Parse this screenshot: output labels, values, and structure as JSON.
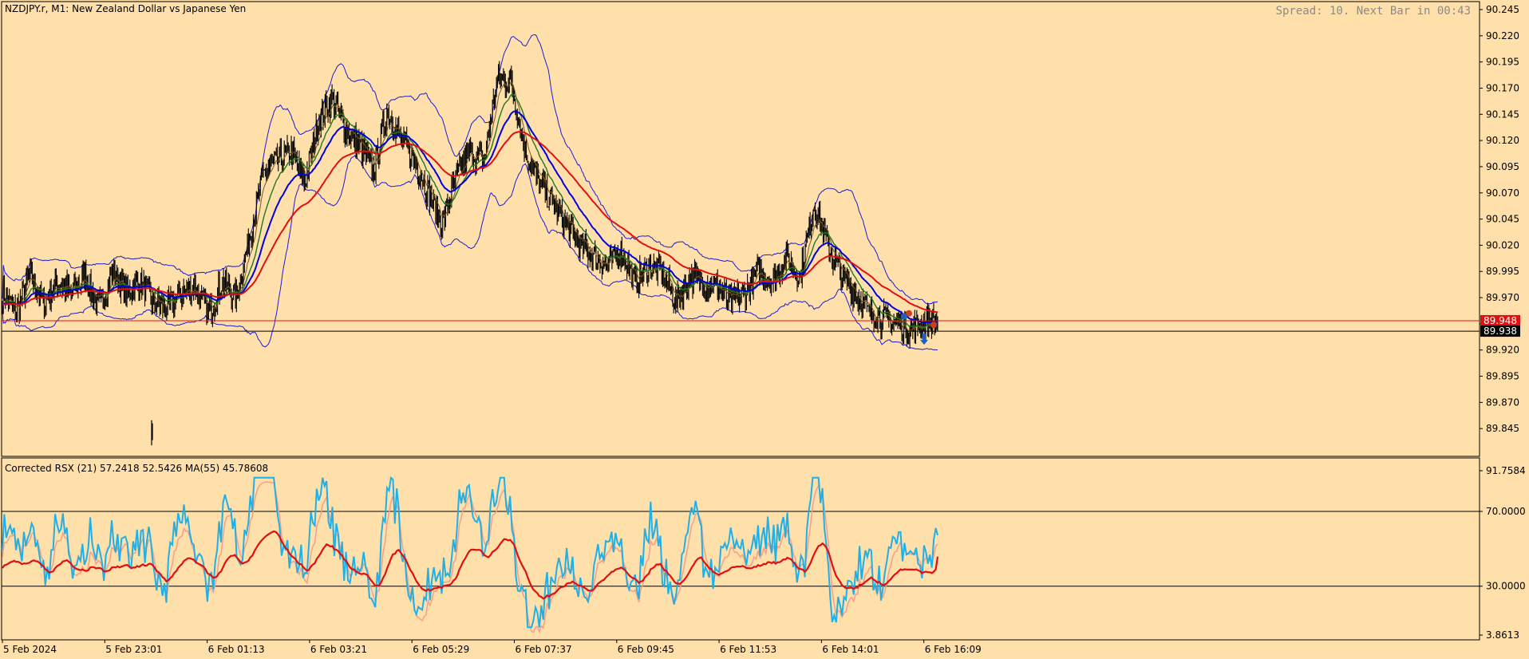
{
  "symbol_title": "NZDJPY.r, M1:  New Zealand Dollar vs Japanese Yen",
  "status_text": "Spread: 10. Next Bar in 00:43",
  "colors": {
    "background": "#ffdfaa",
    "candles": "#000000",
    "bollinger": "#1c1cd8",
    "ma_fast": "#7a5a20",
    "ma_green": "#1e7a1e",
    "ma_blue": "#0000dd",
    "ma_red": "#e01010",
    "rsx_main": "#1fb0e8",
    "rsx_ma": "#e01010",
    "rsx_secondary": "#f4a088",
    "bid_line": "#e01010",
    "ask_line": "#000000",
    "level_lines": "#000000"
  },
  "chart_data": [
    {
      "type": "candlestick",
      "title": "NZDJPY.r, M1:  New Zealand Dollar vs Japanese Yen",
      "ylim": [
        89.82,
        90.245
      ],
      "y_tick_labels": [
        "90.245",
        "90.220",
        "90.195",
        "90.170",
        "90.145",
        "90.120",
        "90.095",
        "90.070",
        "90.045",
        "90.020",
        "89.995",
        "89.970",
        "89.945",
        "89.920",
        "89.895",
        "89.870",
        "89.845"
      ],
      "x_tick_labels": [
        "5 Feb 2024",
        "5 Feb 23:01",
        "6 Feb 01:13",
        "6 Feb 03:21",
        "6 Feb 05:29",
        "6 Feb 07:37",
        "6 Feb 09:45",
        "6 Feb 11:53",
        "6 Feb 14:01",
        "6 Feb 16:09"
      ],
      "close_path": [
        [
          0,
          89.975
        ],
        [
          2,
          89.955
        ],
        [
          4,
          89.992
        ],
        [
          6,
          89.965
        ],
        [
          8,
          89.985
        ],
        [
          10,
          89.975
        ],
        [
          12,
          89.99
        ],
        [
          14,
          89.96
        ],
        [
          16,
          89.995
        ],
        [
          18,
          89.975
        ],
        [
          20,
          89.985
        ],
        [
          22,
          89.965
        ],
        [
          24,
          89.96
        ],
        [
          26,
          89.975
        ],
        [
          28,
          89.98
        ],
        [
          30,
          89.955
        ],
        [
          32,
          89.985
        ],
        [
          34,
          89.97
        ],
        [
          36,
          90.03
        ],
        [
          38,
          90.09
        ],
        [
          40,
          90.1
        ],
        [
          42,
          90.11
        ],
        [
          44,
          90.08
        ],
        [
          46,
          90.14
        ],
        [
          48,
          90.16
        ],
        [
          50,
          90.13
        ],
        [
          52,
          90.115
        ],
        [
          54,
          90.09
        ],
        [
          56,
          90.15
        ],
        [
          58,
          90.12
        ],
        [
          60,
          90.1
        ],
        [
          62,
          90.07
        ],
        [
          64,
          90.04
        ],
        [
          66,
          90.085
        ],
        [
          68,
          90.11
        ],
        [
          70,
          90.1
        ],
        [
          72,
          90.18
        ],
        [
          74,
          90.175
        ],
        [
          76,
          90.11
        ],
        [
          78,
          90.08
        ],
        [
          80,
          90.06
        ],
        [
          82,
          90.04
        ],
        [
          84,
          90.02
        ],
        [
          86,
          90.01
        ],
        [
          88,
          90.0
        ],
        [
          90,
          90.015
        ],
        [
          92,
          89.985
        ],
        [
          94,
          90.0
        ],
        [
          96,
          89.995
        ],
        [
          98,
          89.965
        ],
        [
          100,
          89.99
        ],
        [
          102,
          89.985
        ],
        [
          104,
          89.98
        ],
        [
          106,
          89.965
        ],
        [
          108,
          89.975
        ],
        [
          110,
          89.995
        ],
        [
          112,
          89.985
        ],
        [
          114,
          90.01
        ],
        [
          116,
          89.99
        ],
        [
          118,
          90.06
        ],
        [
          120,
          90.02
        ],
        [
          122,
          89.99
        ],
        [
          124,
          89.975
        ],
        [
          126,
          89.955
        ],
        [
          128,
          89.95
        ],
        [
          130,
          89.945
        ],
        [
          132,
          89.94
        ],
        [
          134,
          89.945
        ],
        [
          136,
          89.95
        ]
      ],
      "price_labels": [
        {
          "label": "89.948",
          "value": 89.948,
          "kind": "bid"
        },
        {
          "label": "89.938",
          "value": 89.938,
          "kind": "ask"
        }
      ],
      "series": [
        {
          "kind": "bollinger_upper"
        },
        {
          "kind": "bollinger_lower"
        },
        {
          "kind": "ma_fast"
        },
        {
          "kind": "ma_green"
        },
        {
          "kind": "ma_blue"
        },
        {
          "kind": "ma_red"
        }
      ]
    },
    {
      "type": "line",
      "title": "Corrected RSX (21) 57.2418 52.5426 MA(55) 45.78608",
      "ylim": [
        3.8613,
        91.7584
      ],
      "y_tick_labels": [
        "91.7584",
        "70.0000",
        "30.0000",
        "3.8613"
      ],
      "levels": [
        70,
        30
      ],
      "series": [
        {
          "kind": "rsx_main",
          "last": 57.2418
        },
        {
          "kind": "rsx_secondary",
          "last": 52.5426
        },
        {
          "kind": "rsx_ma",
          "last": 45.78608
        }
      ]
    }
  ]
}
